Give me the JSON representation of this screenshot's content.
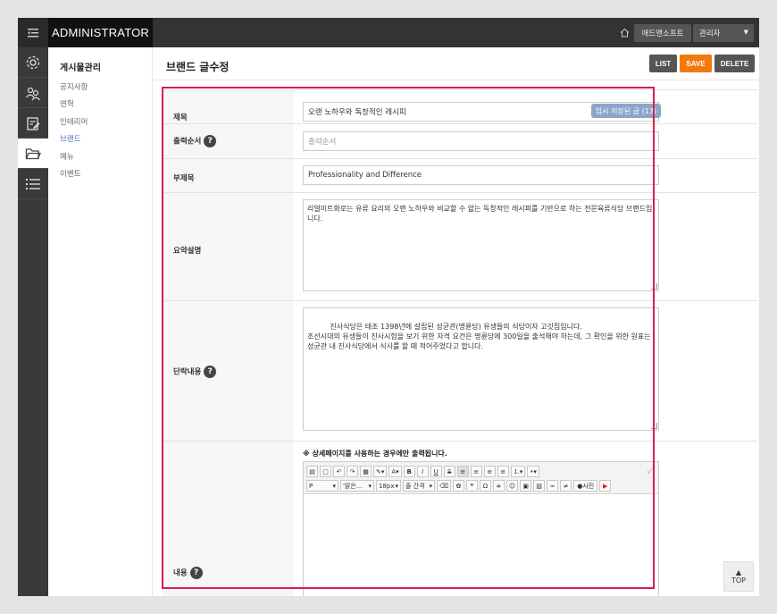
{
  "header": {
    "brand": "ADMINISTRATOR",
    "site_button": "애드앤소프트",
    "admin_dropdown": "관리자"
  },
  "icons": {
    "menu": "menu-collapse-icon",
    "home": "home-icon",
    "settings": "gear-icon",
    "users": "users-icon",
    "board": "board-icon",
    "folder": "folder-icon",
    "list": "list-icon"
  },
  "sidebar": {
    "title": "게시물관리",
    "items": [
      {
        "label": "공지사항",
        "active": false
      },
      {
        "label": "연혁",
        "active": false
      },
      {
        "label": "인테리어",
        "active": false
      },
      {
        "label": "브랜드",
        "active": true
      },
      {
        "label": "메뉴",
        "active": false
      },
      {
        "label": "이벤트",
        "active": false
      }
    ]
  },
  "page": {
    "title": "브랜드 글수정",
    "actions": {
      "list": "LIST",
      "save": "SAVE",
      "delete": "DELETE"
    }
  },
  "form": {
    "title": {
      "label": "제목",
      "value": "오랜 노하우와 독창적인 레시피",
      "temp_saved": "임시 저장된 글 (13)"
    },
    "order": {
      "label": "출력순서",
      "placeholder": "출력순서"
    },
    "subtitle": {
      "label": "부제목",
      "value": "Professionality and Difference"
    },
    "summary": {
      "label": "요약설명",
      "value": "리얼미트화로는 유류 요리의 오랜 노하우와 비교할 수 없는 독창적인 레시피를 기반으로 하는 전문육류식당 브랜드입니다."
    },
    "paragraph": {
      "label": "단락내용",
      "value": "진사식당은 태조 1398년에 설립된 성균관(명륜당) 유생들의 식당이자 고깃집입니다.\n조선시대의 유생들이 진사시험을 보기 위한 자격 요건은 명륜당에 300일을 출석해야 하는데, 그 확인을 위한 원표는 성균관 내 진사식당에서 식사를 할 때 적어주었다고 합니다."
    },
    "content": {
      "label": "내용",
      "note": "※ 상세페이지를 사용하는 경우에만 출력됩니다.",
      "format_select": "P",
      "font_select": "'맑은...",
      "size_select": "18px",
      "spacing_select": "줄 간격",
      "photo_button": "사진"
    }
  },
  "top_button": "TOP",
  "colors": {
    "save": "#f27a0c",
    "highlight": "#d81b56",
    "active_nav": "#4a6cc4"
  }
}
